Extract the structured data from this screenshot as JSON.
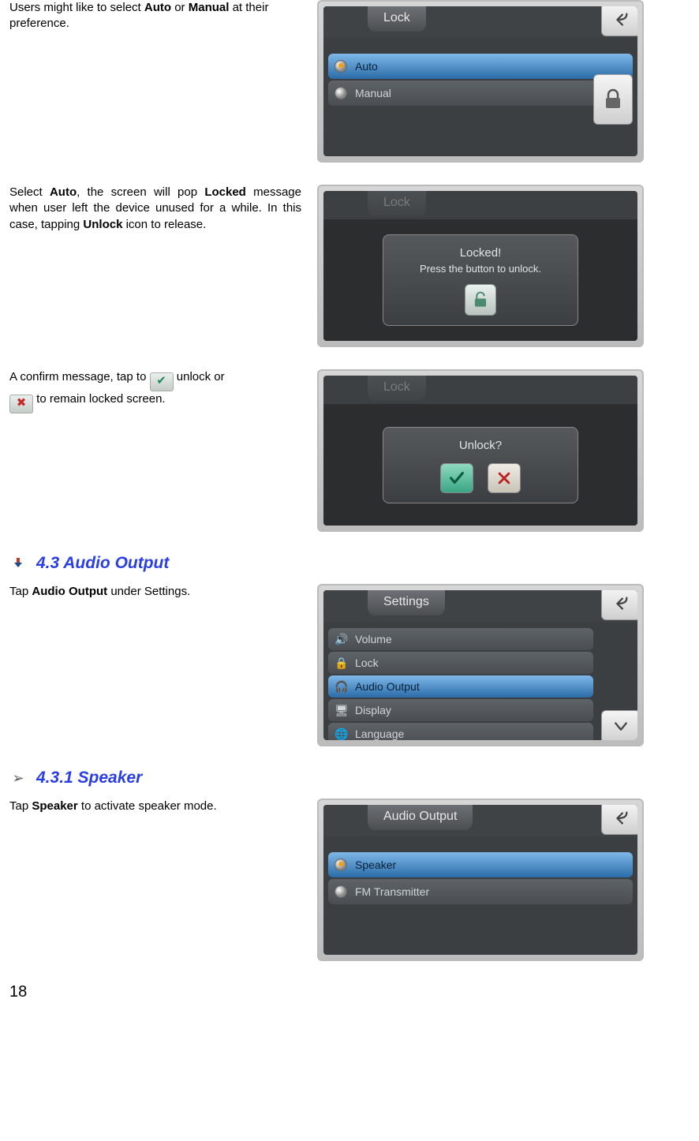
{
  "section1": {
    "para_before": "Users might like to select ",
    "bold1": "Auto",
    "mid1": " or ",
    "bold2": "Manual",
    "after1": " at their preference.",
    "screen": {
      "title": "Lock",
      "items": [
        "Auto",
        "Manual"
      ]
    }
  },
  "section2": {
    "frag1": "Select ",
    "bold1": "Auto",
    "frag2": ", the screen will pop ",
    "bold2": "Locked",
    "frag3": " message when user left the device unused for a while.  In this case, tapping ",
    "bold3": "Unlock",
    "frag4": " icon to release.",
    "dialog": {
      "line1": "Locked!",
      "line2": "Press the button to unlock."
    }
  },
  "section3": {
    "frag1": "A confirm message, tap to ",
    "frag2": " unlock or ",
    "frag3": " to remain locked screen.",
    "dialog_title": "Unlock?"
  },
  "heading_audio": "4.3 Audio Output",
  "section4": {
    "frag1": "Tap ",
    "bold1": "Audio Output",
    "frag2": " under Settings.",
    "screen": {
      "title": "Settings",
      "items": [
        "Volume",
        "Lock",
        "Audio Output",
        "Display",
        "Language"
      ]
    }
  },
  "heading_speaker": "4.3.1 Speaker",
  "section5": {
    "frag1": "Tap ",
    "bold1": "Speaker",
    "frag2": " to activate speaker mode.",
    "screen": {
      "title": "Audio Output",
      "items": [
        "Speaker",
        "FM Transmitter"
      ]
    }
  },
  "page_number": "18"
}
